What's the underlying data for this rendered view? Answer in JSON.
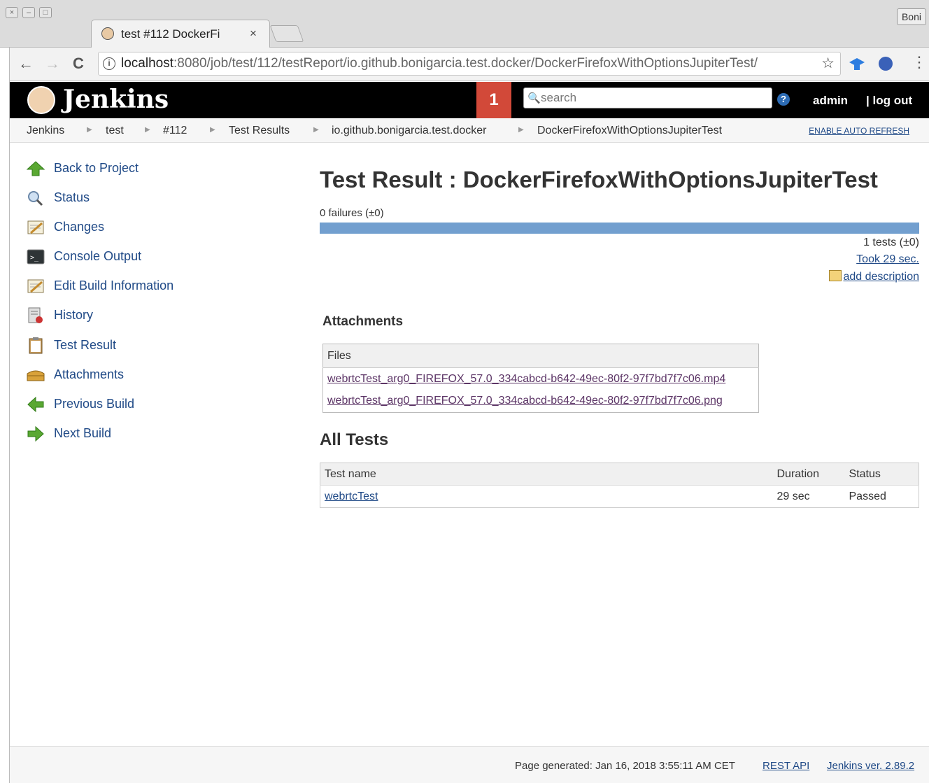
{
  "browser": {
    "tab_title": "test #112 DockerFi",
    "tab_close": "×",
    "user_badge": "Boni",
    "url_host": "localhost",
    "url_rest": ":8080/job/test/112/testReport/io.github.bonigarcia.test.docker/DockerFirefoxWithOptionsJupiterTest/",
    "back": "←",
    "forward": "→",
    "reload": "C",
    "star": "☆",
    "menu": "⋮",
    "info": "i"
  },
  "header": {
    "logo": "Jenkins",
    "notifications": "1",
    "search_placeholder": "search",
    "help": "?",
    "user": "admin",
    "logout": "| log out"
  },
  "breadcrumbs": {
    "items": [
      "Jenkins",
      "test",
      "#112",
      "Test Results",
      "io.github.bonigarcia.test.docker",
      "DockerFirefoxWithOptionsJupiterTest"
    ],
    "auto_refresh": "ENABLE AUTO REFRESH"
  },
  "sidebar": {
    "items": [
      {
        "label": "Back to Project",
        "icon": "up-arrow-icon"
      },
      {
        "label": "Status",
        "icon": "magnifier-icon"
      },
      {
        "label": "Changes",
        "icon": "notepad-icon"
      },
      {
        "label": "Console Output",
        "icon": "terminal-icon"
      },
      {
        "label": "Edit Build Information",
        "icon": "notepad-icon"
      },
      {
        "label": "History",
        "icon": "history-icon"
      },
      {
        "label": "Test Result",
        "icon": "clipboard-icon"
      },
      {
        "label": "Attachments",
        "icon": "box-icon"
      },
      {
        "label": "Previous Build",
        "icon": "left-arrow-icon"
      },
      {
        "label": "Next Build",
        "icon": "right-arrow-icon"
      }
    ]
  },
  "main": {
    "title": "Test Result : DockerFirefoxWithOptionsJupiterTest",
    "failures": "0 failures (±0)",
    "tests_count": "1 tests (±0)",
    "took": "Took 29 sec.",
    "add_description": "add description",
    "attachments_heading": "Attachments",
    "files_header": "Files",
    "files": [
      "webrtcTest_arg0_FIREFOX_57.0_334cabcd-b642-49ec-80f2-97f7bd7f7c06.mp4",
      "webrtcTest_arg0_FIREFOX_57.0_334cabcd-b642-49ec-80f2-97f7bd7f7c06.png"
    ],
    "all_tests_heading": "All Tests",
    "tests_headers": {
      "name": "Test name",
      "duration": "Duration",
      "status": "Status"
    },
    "tests": [
      {
        "name": "webrtcTest",
        "duration": "29 sec",
        "status": "Passed"
      }
    ]
  },
  "footer": {
    "generated": "Page generated: Jan 16, 2018 3:55:11 AM CET",
    "rest_api": "REST API",
    "version": "Jenkins ver. 2.89.2"
  },
  "colors": {
    "header_bg": "#000000",
    "notification": "#d24939",
    "link": "#204a87",
    "progress": "#729fcf"
  },
  "test_pass_ratio": 1.0
}
